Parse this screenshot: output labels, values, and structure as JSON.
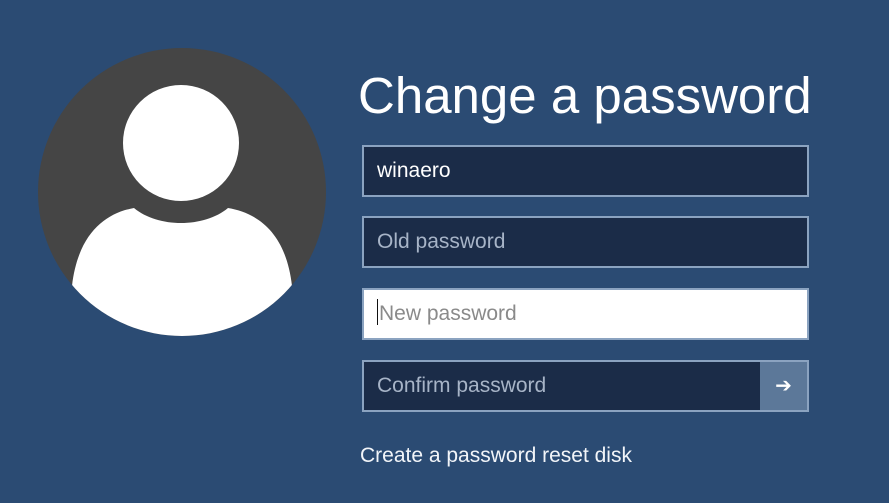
{
  "title": "Change a password",
  "fields": {
    "username": {
      "value": "winaero"
    },
    "old_password": {
      "placeholder": "Old password"
    },
    "new_password": {
      "placeholder": "New password"
    },
    "confirm_password": {
      "placeholder": "Confirm password"
    }
  },
  "submit_icon": "arrow-right-icon",
  "submit_glyph": "➔",
  "reset_link": "Create a password reset disk",
  "colors": {
    "background": "#2b4b73",
    "input_bg": "#1b2c48",
    "input_border": "#8ba3c0",
    "submit_bg": "#5c7899",
    "avatar_bg": "#454545"
  }
}
